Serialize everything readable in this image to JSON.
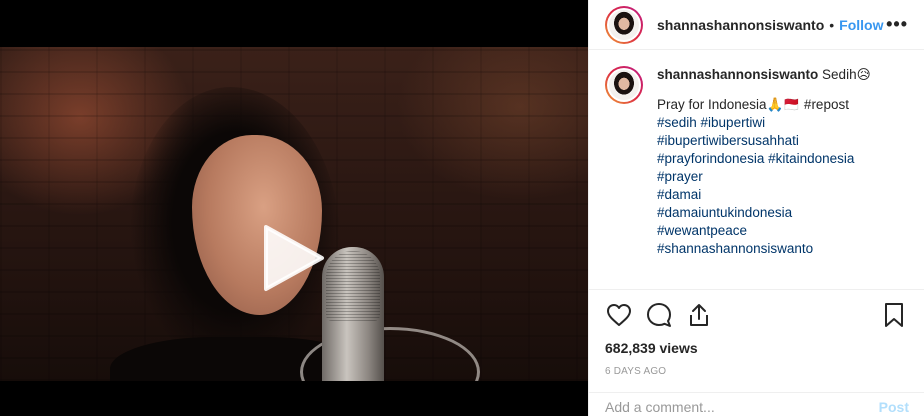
{
  "post": {
    "username": "shannashannonsiswanto",
    "separator": "•",
    "follow_label": "Follow",
    "more_label": "•••",
    "caption": {
      "username": "shannashannonsiswanto",
      "text": "Sedih😥",
      "line1": "Pray for Indonesia🙏🇲🇨 #repost",
      "hashtags": [
        "#sedih #ibupertiwi",
        "#ibupertiwibersusahhati",
        "#prayforindonesia #kitaindonesia",
        "#prayer",
        "#damai",
        "#damaiuntukindonesia",
        "#wewantpeace",
        "#shannashannonsiswanto"
      ]
    },
    "actions": {
      "like_icon": "heart-icon",
      "comment_icon": "comment-bubble-icon",
      "share_icon": "share-icon",
      "save_icon": "bookmark-icon"
    },
    "views": "682,839 views",
    "timestamp": "6 DAYS AGO",
    "comment": {
      "placeholder": "Add a comment...",
      "post_label": "Post"
    }
  },
  "media": {
    "type": "video",
    "play_icon": "play-icon"
  },
  "colors": {
    "link_blue": "#3897f0",
    "hashtag_blue": "#003569",
    "post_disabled": "#b2dffc",
    "muted": "#999999"
  }
}
